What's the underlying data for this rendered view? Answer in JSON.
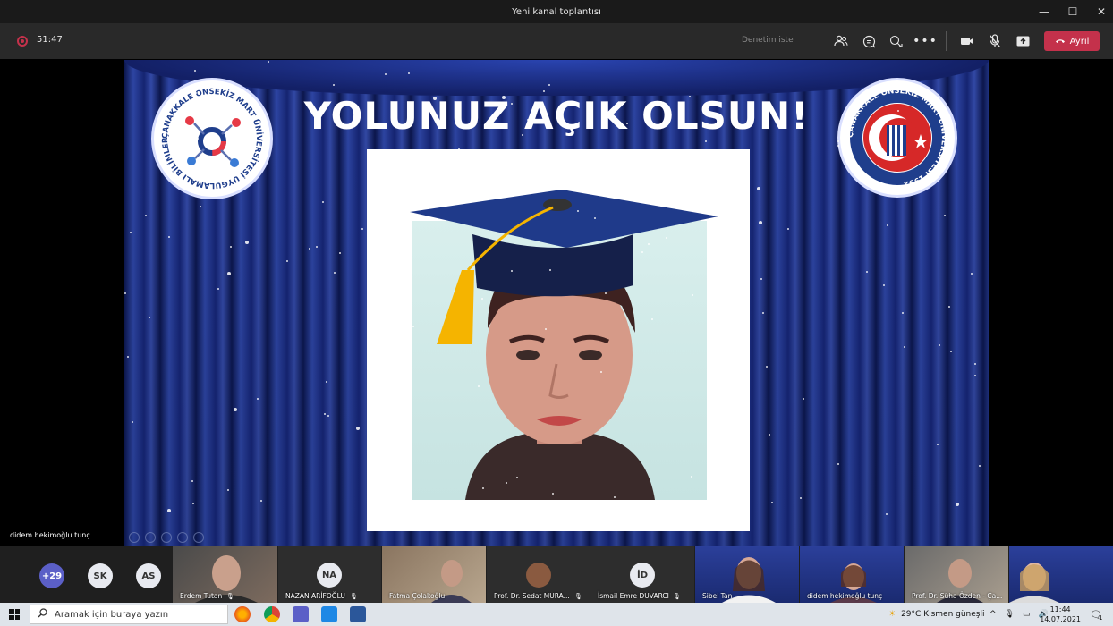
{
  "window": {
    "title": "Yeni kanal toplantısı",
    "controls": {
      "minimize": "—",
      "maximize": "☐",
      "close": "✕"
    }
  },
  "toolbar": {
    "timer": "51:47",
    "control_text": "Denetim iste",
    "leave_label": "Ayrıl",
    "leave_color": "#c4314b"
  },
  "stage": {
    "slide_title": "YOLUNUZ AÇIK OLSUN!",
    "presenter_name": "didem hekimoğlu tunç",
    "logo_left_text": "ÇANAKKALE ONSEKİZ MART ÜNİVERSİTESİ UYGULAMALI BİLİMLER FAKÜLTESİ 2020",
    "logo_right_text": "ÇANAKKALE ONSEKİZ MART ÜNİVERSİTESİ 1992"
  },
  "participants": {
    "overflow": "+29",
    "avatars": [
      {
        "initials": "SK",
        "bg": "#e8eaf0"
      },
      {
        "initials": "AS",
        "bg": "#e8eaf0"
      }
    ],
    "tiles": [
      {
        "name": "Erdem Tutan",
        "type": "video"
      },
      {
        "name": "NAZAN ARİFOĞLU",
        "type": "initials",
        "initials": "NA"
      },
      {
        "name": "Fatma Çolakoğlu",
        "type": "video"
      },
      {
        "name": "Prof. Dr. Sedat MURA...",
        "type": "video"
      },
      {
        "name": "İsmail Emre DUVARCI",
        "type": "initials",
        "initials": "İD"
      },
      {
        "name": "Sibel Tan",
        "type": "video"
      },
      {
        "name": "didem hekimoğlu tunç",
        "type": "video"
      },
      {
        "name": "Prof. Dr. Süha Özden - Ça...",
        "type": "video"
      },
      {
        "name": "",
        "type": "video"
      }
    ]
  },
  "taskbar": {
    "search_placeholder": "Aramak için buraya yazın",
    "weather": "29°C  Kısmen güneşli",
    "time": "11:44",
    "date": "14.07.2021",
    "notification_count": "1"
  }
}
